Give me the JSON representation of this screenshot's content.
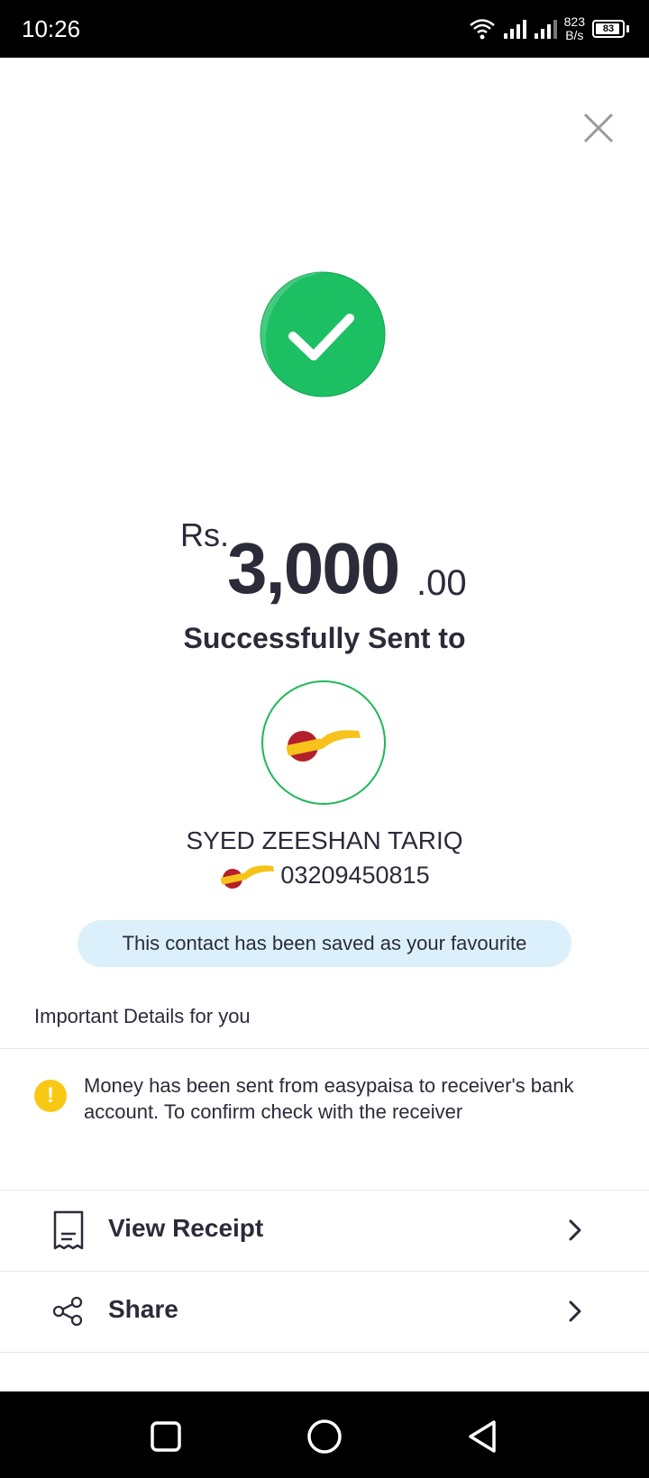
{
  "status_bar": {
    "time": "10:26",
    "net_speed_value": "823",
    "net_speed_unit": "B/s",
    "battery": "83"
  },
  "amount": {
    "currency": "Rs.",
    "whole": "3,000",
    "decimal": ".00"
  },
  "status_message": "Successfully Sent to",
  "recipient": {
    "name": "SYED ZEESHAN TARIQ",
    "number": "03209450815",
    "wallet_logo_icon": "jazzcash-logo"
  },
  "favourite_banner": "This contact has been saved as your favourite",
  "details": {
    "title": "Important Details for you",
    "info_text": "Money has been sent from easypaisa to receiver's bank account. To confirm check with the receiver",
    "info_icon_glyph": "!"
  },
  "actions": [
    {
      "label": "View Receipt",
      "icon": "receipt-icon"
    },
    {
      "label": "Share",
      "icon": "share-icon"
    }
  ],
  "colors": {
    "success_green": "#1cc063",
    "recipient_ring": "#1db954",
    "banner_bg": "#dcf0fb",
    "warning_yellow": "#f8c814",
    "text_dark": "#2b2b3a"
  }
}
